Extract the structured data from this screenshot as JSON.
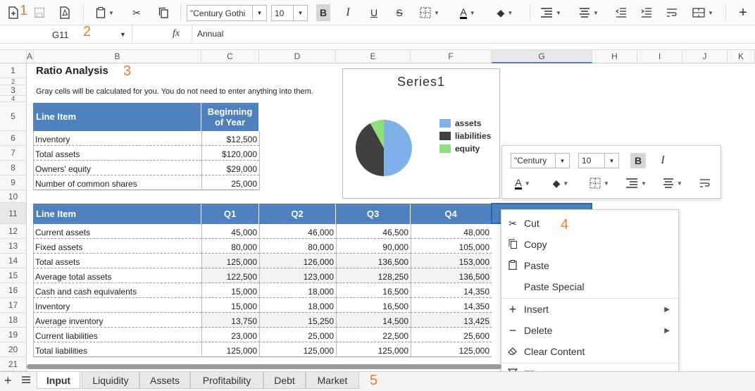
{
  "toolbar": {
    "font_name": "\"Century Gothi",
    "font_size": "10",
    "bold": "B",
    "italic": "I",
    "underline": "U",
    "strike": "S",
    "font_color_glyph": "A",
    "plus": "+"
  },
  "annotations": {
    "a1": "1",
    "a2": "2",
    "a3": "3",
    "a4": "4",
    "a5": "5"
  },
  "formula_bar": {
    "cell_ref": "G11",
    "fx": "fx",
    "value": "Annual"
  },
  "columns": [
    "A",
    "B",
    "C",
    "D",
    "E",
    "F",
    "G",
    "H",
    "I",
    "J",
    "K"
  ],
  "rows": [
    "1",
    "2",
    "3",
    "4",
    "5",
    "6",
    "7",
    "8",
    "9",
    "10",
    "11",
    "12",
    "13",
    "14",
    "15",
    "16",
    "17",
    "18",
    "19",
    "20",
    "21"
  ],
  "sheet": {
    "title": "Ratio Analysis",
    "note": "Gray cells will be calculated for you. You do not need to enter anything into them.",
    "t1_header_item": "Line Item",
    "t1_header_year": "Beginning of Year",
    "t1_rows": [
      {
        "label": "Inventory",
        "value": "$12,500"
      },
      {
        "label": "Total assets",
        "value": "$120,000"
      },
      {
        "label": "Owners' equity",
        "value": "$29,000"
      },
      {
        "label": "Number of common shares",
        "value": "25,000"
      }
    ],
    "t2_headers": [
      "Line Item",
      "Q1",
      "Q2",
      "Q3",
      "Q4"
    ],
    "t2_rows": [
      {
        "label": "Current assets",
        "q": [
          "45,000",
          "46,000",
          "46,500",
          "48,000"
        ]
      },
      {
        "label": "Fixed assets",
        "q": [
          "80,000",
          "80,000",
          "90,000",
          "105,000"
        ]
      },
      {
        "label": "Total assets",
        "q": [
          "125,000",
          "126,000",
          "136,500",
          "153,000"
        ]
      },
      {
        "label": "Average total assets",
        "q": [
          "122,500",
          "123,000",
          "128,250",
          "136,500"
        ]
      },
      {
        "label": "Cash and cash equivalents",
        "q": [
          "15,000",
          "18,000",
          "16,500",
          "14,350"
        ]
      },
      {
        "label": "Inventory",
        "q": [
          "15,000",
          "18,000",
          "16,500",
          "14,350"
        ]
      },
      {
        "label": "Average inventory",
        "q": [
          "13,750",
          "15,250",
          "14,500",
          "13,425"
        ]
      },
      {
        "label": "Current liabilities",
        "q": [
          "23,000",
          "25,000",
          "22,500",
          "25,600"
        ]
      },
      {
        "label": "Total liabilities",
        "q": [
          "125,000",
          "125,000",
          "125,000",
          "125,000"
        ]
      }
    ]
  },
  "chart": {
    "title": "Series1",
    "legend": [
      {
        "name": "assets",
        "color": "#7eb2e8"
      },
      {
        "name": "liabilities",
        "color": "#404040"
      },
      {
        "name": "equity",
        "color": "#8de07a"
      }
    ]
  },
  "chart_data": {
    "type": "pie",
    "title": "Series1",
    "categories": [
      "assets",
      "liabilities",
      "equity"
    ],
    "values": [
      50,
      42,
      8
    ],
    "legend": "right"
  },
  "mini_toolbar": {
    "font": "\"Century",
    "size": "10",
    "bold": "B",
    "italic": "I",
    "font_color_glyph": "A"
  },
  "context_menu": {
    "items": [
      "Cut",
      "Copy",
      "Paste",
      "Paste Special",
      "Insert",
      "Delete",
      "Clear Content",
      "Filter"
    ]
  },
  "tabs": [
    "Input",
    "Liquidity",
    "Assets",
    "Profitability",
    "Debt",
    "Market"
  ]
}
